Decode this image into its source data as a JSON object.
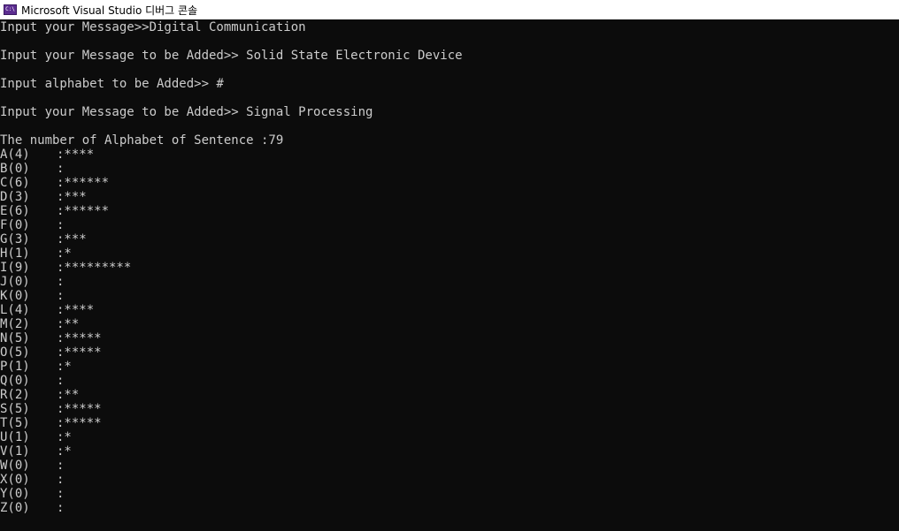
{
  "window": {
    "icon_text": "C:\\",
    "title": "Microsoft Visual Studio 디버그 콘솔"
  },
  "console": {
    "lines": [
      "Input your Message>>Digital Communication",
      "",
      "Input your Message to be Added>> Solid State Electronic Device",
      "",
      "Input alphabet to be Added>> #",
      "",
      "Input your Message to be Added>> Signal Processing",
      "",
      "The number of Alphabet of Sentence :79"
    ],
    "histogram": [
      {
        "label": "A(4)",
        "bar": ":****"
      },
      {
        "label": "B(0)",
        "bar": ":"
      },
      {
        "label": "C(6)",
        "bar": ":******"
      },
      {
        "label": "D(3)",
        "bar": ":***"
      },
      {
        "label": "E(6)",
        "bar": ":******"
      },
      {
        "label": "F(0)",
        "bar": ":"
      },
      {
        "label": "G(3)",
        "bar": ":***"
      },
      {
        "label": "H(1)",
        "bar": ":*"
      },
      {
        "label": "I(9)",
        "bar": ":*********"
      },
      {
        "label": "J(0)",
        "bar": ":"
      },
      {
        "label": "K(0)",
        "bar": ":"
      },
      {
        "label": "L(4)",
        "bar": ":****"
      },
      {
        "label": "M(2)",
        "bar": ":**"
      },
      {
        "label": "N(5)",
        "bar": ":*****"
      },
      {
        "label": "O(5)",
        "bar": ":*****"
      },
      {
        "label": "P(1)",
        "bar": ":*"
      },
      {
        "label": "Q(0)",
        "bar": ":"
      },
      {
        "label": "R(2)",
        "bar": ":**"
      },
      {
        "label": "S(5)",
        "bar": ":*****"
      },
      {
        "label": "T(5)",
        "bar": ":*****"
      },
      {
        "label": "U(1)",
        "bar": ":*"
      },
      {
        "label": "V(1)",
        "bar": ":*"
      },
      {
        "label": "W(0)",
        "bar": ":"
      },
      {
        "label": "X(0)",
        "bar": ":"
      },
      {
        "label": "Y(0)",
        "bar": ":"
      },
      {
        "label": "Z(0)",
        "bar": ":"
      }
    ]
  },
  "colors": {
    "background": "#0c0c0c",
    "text": "#cccccc",
    "titlebar": "#ffffff",
    "icon": "#5c2d91"
  }
}
